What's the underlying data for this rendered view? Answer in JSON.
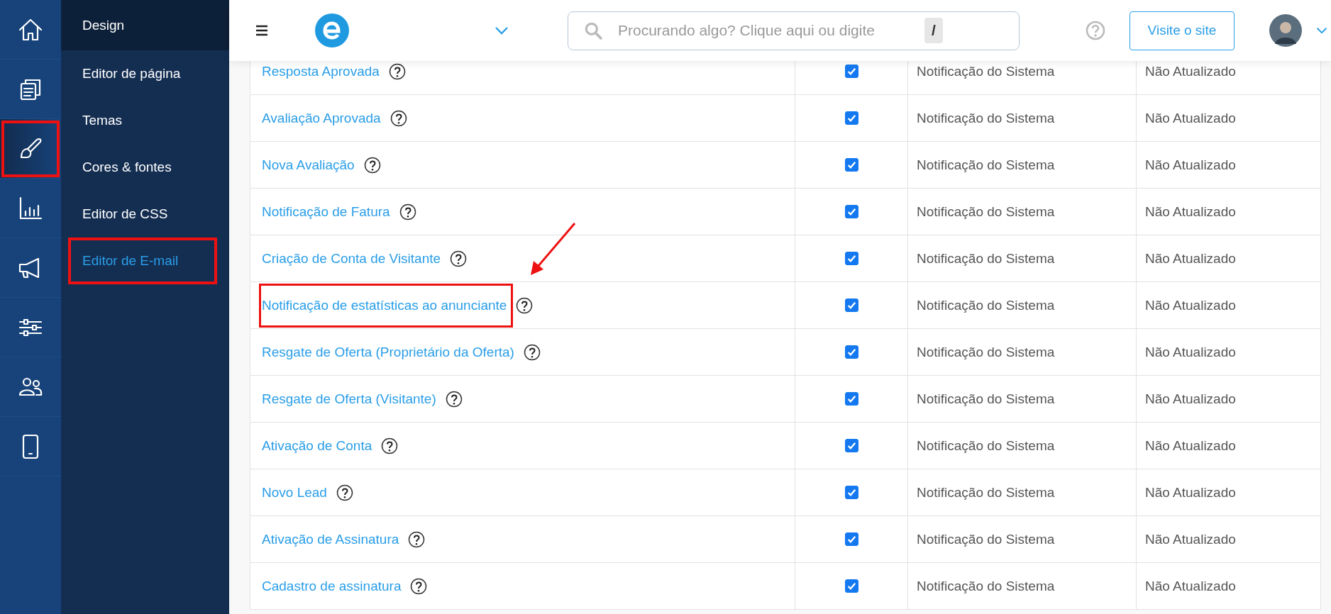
{
  "sidebar": {
    "rail": [
      {
        "kind": "home",
        "selected": false,
        "highlighted": false
      },
      {
        "kind": "pages",
        "selected": false,
        "highlighted": false
      },
      {
        "kind": "brush",
        "selected": true,
        "highlighted": true
      },
      {
        "kind": "chart",
        "selected": false,
        "highlighted": false
      },
      {
        "kind": "megaphone",
        "selected": false,
        "highlighted": false
      },
      {
        "kind": "sliders",
        "selected": false,
        "highlighted": false
      },
      {
        "kind": "users",
        "selected": false,
        "highlighted": false
      },
      {
        "kind": "tablet",
        "selected": false,
        "highlighted": false
      }
    ],
    "submenu": {
      "title": "Design",
      "items": [
        {
          "label": "Editor de página",
          "selected": false,
          "highlighted": false
        },
        {
          "label": "Temas",
          "selected": false,
          "highlighted": false
        },
        {
          "label": "Cores & fontes",
          "selected": false,
          "highlighted": false
        },
        {
          "label": "Editor de CSS",
          "selected": false,
          "highlighted": false
        },
        {
          "label": "Editor de E-mail",
          "selected": true,
          "highlighted": true
        }
      ]
    }
  },
  "header": {
    "search": {
      "placeholder": "Procurando algo? Clique aqui ou digite",
      "shortcut": "/"
    },
    "visit_button": "Visite o site"
  },
  "table": {
    "rows": [
      {
        "name": "Resposta Aprovada",
        "enabled": true,
        "type": "Notificação do Sistema",
        "status": "Não Atualizado",
        "highlighted": false
      },
      {
        "name": "Avaliação Aprovada",
        "enabled": true,
        "type": "Notificação do Sistema",
        "status": "Não Atualizado",
        "highlighted": false
      },
      {
        "name": "Nova Avaliação",
        "enabled": true,
        "type": "Notificação do Sistema",
        "status": "Não Atualizado",
        "highlighted": false
      },
      {
        "name": "Notificação de Fatura",
        "enabled": true,
        "type": "Notificação do Sistema",
        "status": "Não Atualizado",
        "highlighted": false
      },
      {
        "name": "Criação de Conta de Visitante",
        "enabled": true,
        "type": "Notificação do Sistema",
        "status": "Não Atualizado",
        "highlighted": false
      },
      {
        "name": "Notificação de estatísticas ao anunciante",
        "enabled": true,
        "type": "Notificação do Sistema",
        "status": "Não Atualizado",
        "highlighted": true
      },
      {
        "name": "Resgate de Oferta (Proprietário da Oferta)",
        "enabled": true,
        "type": "Notificação do Sistema",
        "status": "Não Atualizado",
        "highlighted": false
      },
      {
        "name": "Resgate de Oferta (Visitante)",
        "enabled": true,
        "type": "Notificação do Sistema",
        "status": "Não Atualizado",
        "highlighted": false
      },
      {
        "name": "Ativação de Conta",
        "enabled": true,
        "type": "Notificação do Sistema",
        "status": "Não Atualizado",
        "highlighted": false
      },
      {
        "name": "Novo Lead",
        "enabled": true,
        "type": "Notificação do Sistema",
        "status": "Não Atualizado",
        "highlighted": false
      },
      {
        "name": "Ativação de Assinatura",
        "enabled": true,
        "type": "Notificação do Sistema",
        "status": "Não Atualizado",
        "highlighted": false
      },
      {
        "name": "Cadastro de assinatura",
        "enabled": true,
        "type": "Notificação do Sistema",
        "status": "Não Atualizado",
        "highlighted": false
      }
    ]
  },
  "annotation_arrow": {
    "visible": true
  }
}
